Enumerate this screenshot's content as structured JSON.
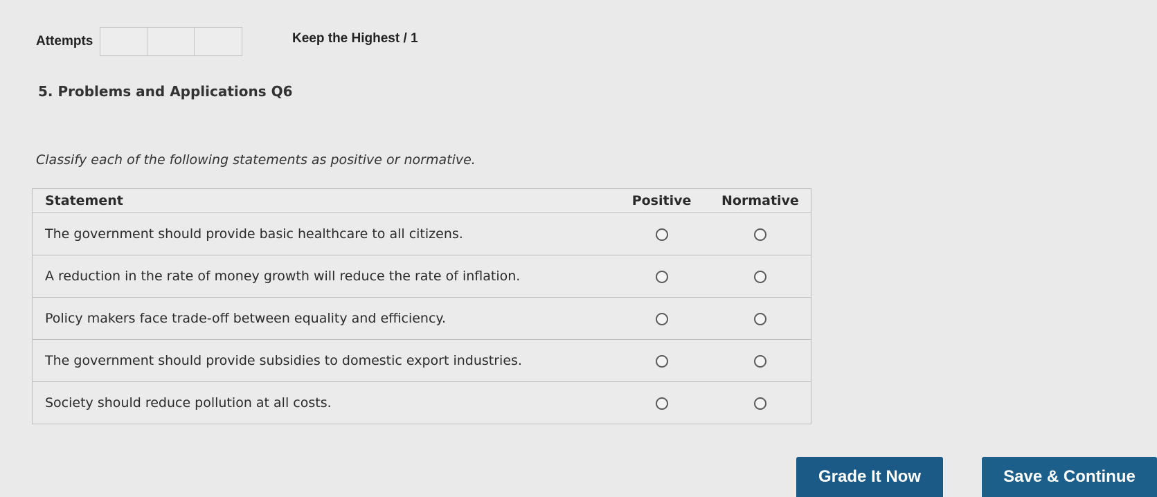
{
  "attempts": {
    "label": "Attempts",
    "box_count": 3,
    "keep_highest": "Keep the Highest / 1"
  },
  "question": {
    "title": "5. Problems and Applications Q6",
    "instructions": "Classify each of the following statements as positive or normative."
  },
  "table": {
    "headers": {
      "statement": "Statement",
      "positive": "Positive",
      "normative": "Normative"
    },
    "rows": [
      {
        "statement": "The government should provide basic healthcare to all citizens."
      },
      {
        "statement": "A reduction in the rate of money growth will reduce the rate of inflation."
      },
      {
        "statement": "Policy makers face trade-off between equality and efficiency."
      },
      {
        "statement": "The government should provide subsidies to domestic export industries."
      },
      {
        "statement": "Society should reduce pollution at all costs."
      }
    ]
  },
  "buttons": {
    "grade": "Grade It Now",
    "save": "Save & Continue"
  },
  "colors": {
    "button_blue": "#1b5a86",
    "background": "#eaeaea"
  }
}
